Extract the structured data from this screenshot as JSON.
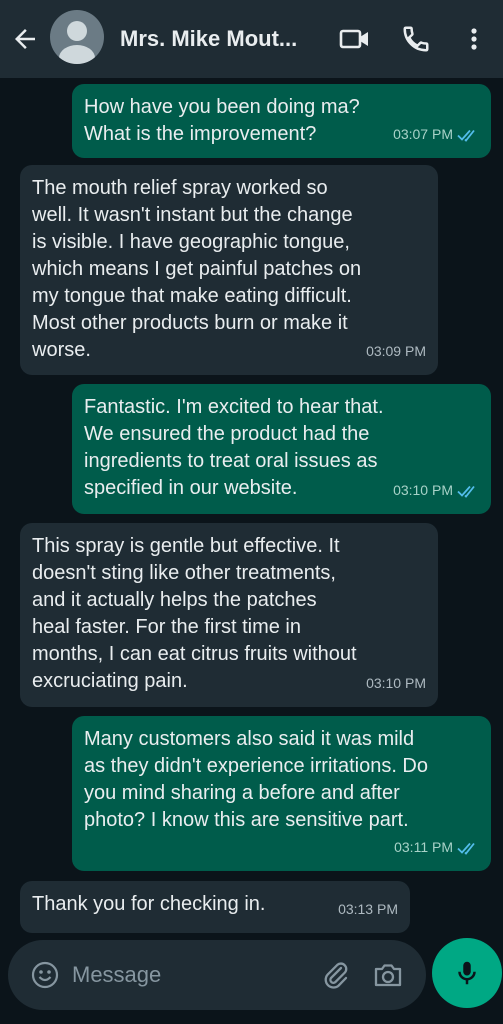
{
  "header": {
    "contact_name": "Mrs. Mike Mout...",
    "icons": [
      "back-arrow-icon",
      "avatar-placeholder-icon",
      "video-call-icon",
      "voice-call-icon",
      "more-options-icon"
    ]
  },
  "messages": [
    {
      "direction": "outgoing",
      "text": "How have you been doing ma?\nWhat is the improvement?",
      "time": "03:07 PM",
      "status": "read"
    },
    {
      "direction": "incoming",
      "text": "The mouth relief spray worked so\nwell. It wasn't instant but the change\nis visible. I have geographic tongue,\nwhich means I get painful patches on\nmy tongue that make eating difficult.\nMost other products burn or make it\nworse.",
      "time": "03:09 PM"
    },
    {
      "direction": "outgoing",
      "text": "Fantastic. I'm excited to hear that.\nWe ensured the product had the\ningredients to treat oral issues as\nspecified in our website.",
      "time": "03:10 PM",
      "status": "read"
    },
    {
      "direction": "incoming",
      "text": "This spray is gentle but effective. It\ndoesn't sting like other treatments,\nand it actually helps the patches\nheal faster. For the first time in\nmonths, I can eat citrus fruits without\nexcruciating pain.",
      "time": "03:10 PM"
    },
    {
      "direction": "outgoing",
      "text": "Many customers also said it was mild\nas they didn't experience irritations. Do\nyou mind sharing a before and after\nphoto? I know this are sensitive part.",
      "time": "03:11 PM",
      "status": "read"
    },
    {
      "direction": "incoming",
      "text": "Thank you for checking in.",
      "time": "03:13 PM"
    }
  ],
  "composer": {
    "placeholder": "Message",
    "icons": [
      "emoji-icon",
      "attach-icon",
      "camera-icon",
      "mic-icon"
    ]
  },
  "colors": {
    "background": "#0b141a",
    "header": "#1f2c34",
    "outgoing_bubble": "#005c4b",
    "incoming_bubble": "#1f2c34",
    "accent": "#00a884",
    "read_ticks": "#53bdeb"
  }
}
